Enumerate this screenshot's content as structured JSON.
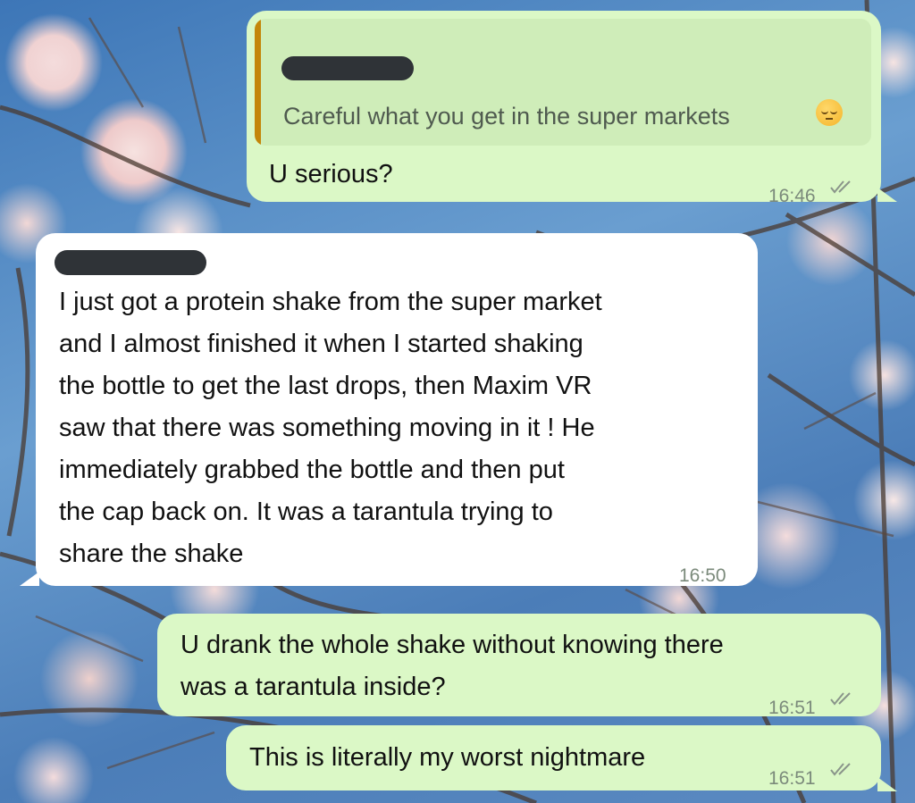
{
  "messages": [
    {
      "direction": "outgoing",
      "quoted_text": "Careful what you get in the super markets",
      "quoted_emoji": "pensive-face-emoji",
      "lines": [
        "U serious?"
      ],
      "time": "16:46",
      "status": "read"
    },
    {
      "direction": "incoming",
      "lines": [
        "I just got a protein shake from the super market",
        "and I almost finished it when I started shaking",
        "the bottle to get the last drops, then Maxim VR",
        "saw that there was something moving in it ! He",
        "immediately grabbed the bottle and then put",
        "the cap back on. It was a tarantula trying to",
        "share the shake"
      ],
      "time": "16:50"
    },
    {
      "direction": "outgoing",
      "lines": [
        "U drank the whole shake without knowing there",
        "was a tarantula inside?"
      ],
      "time": "16:51",
      "status": "read"
    },
    {
      "direction": "outgoing",
      "lines": [
        "This is literally my worst nightmare"
      ],
      "time": "16:51",
      "status": "read"
    }
  ],
  "colors": {
    "outgoing_bubble": "#dbf8c6",
    "incoming_bubble": "#ffffff",
    "quote_bar": "#c4860a",
    "redaction": "#2f3337"
  }
}
